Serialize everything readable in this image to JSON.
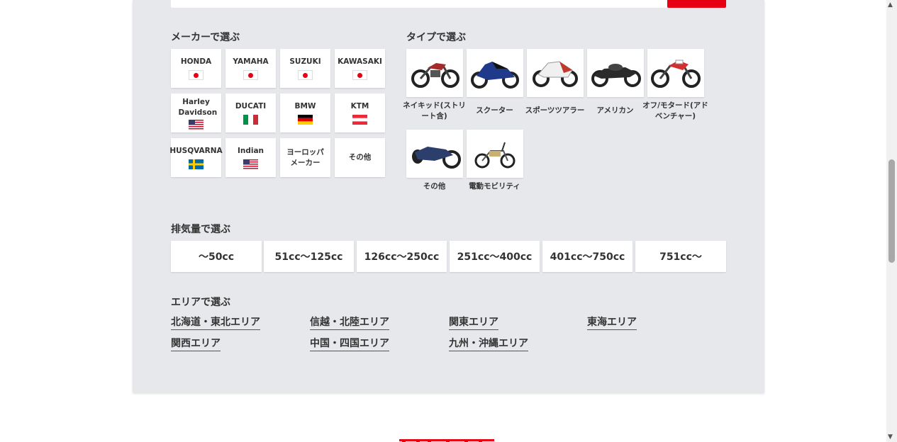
{
  "colors": {
    "accent": "#e60012",
    "panel_bg": "#e6e8eb"
  },
  "makers": {
    "title": "メーカーで選ぶ",
    "items": [
      {
        "label": "HONDA",
        "flag": "jp"
      },
      {
        "label": "YAMAHA",
        "flag": "jp"
      },
      {
        "label": "SUZUKI",
        "flag": "jp"
      },
      {
        "label": "KAWASAKI",
        "flag": "jp"
      },
      {
        "label": "Harley Davidson",
        "flag": "us"
      },
      {
        "label": "DUCATI",
        "flag": "it"
      },
      {
        "label": "BMW",
        "flag": "de"
      },
      {
        "label": "KTM",
        "flag": "at"
      },
      {
        "label": "HUSQVARNA",
        "flag": "se"
      },
      {
        "label": "Indian",
        "flag": "us"
      },
      {
        "label": "ヨーロッパメーカー",
        "flag": ""
      },
      {
        "label": "その他",
        "flag": ""
      }
    ]
  },
  "types": {
    "title": "タイプで選ぶ",
    "items": [
      {
        "label": "ネイキッド(ストリート含)",
        "icon": "naked-bike-image"
      },
      {
        "label": "スクーター",
        "icon": "scooter-image"
      },
      {
        "label": "スポーツツアラー",
        "icon": "sport-tourer-image"
      },
      {
        "label": "アメリカン",
        "icon": "american-bike-image"
      },
      {
        "label": "オフ/モタード(アドベンチャー)",
        "icon": "offroad-bike-image"
      },
      {
        "label": "その他",
        "icon": "three-wheeler-image"
      },
      {
        "label": "電動モビリティ",
        "icon": "e-bike-image"
      }
    ]
  },
  "displacement": {
    "title": "排気量で選ぶ",
    "items": [
      "〜50cc",
      "51cc〜125cc",
      "126cc〜250cc",
      "251cc〜400cc",
      "401cc〜750cc",
      "751cc〜"
    ]
  },
  "area": {
    "title": "エリアで選ぶ",
    "items": [
      "北海道・東北エリア",
      "信越・北陸エリア",
      "関東エリア",
      "東海エリア",
      "関西エリア",
      "中国・四国エリア",
      "九州・沖縄エリア"
    ]
  }
}
